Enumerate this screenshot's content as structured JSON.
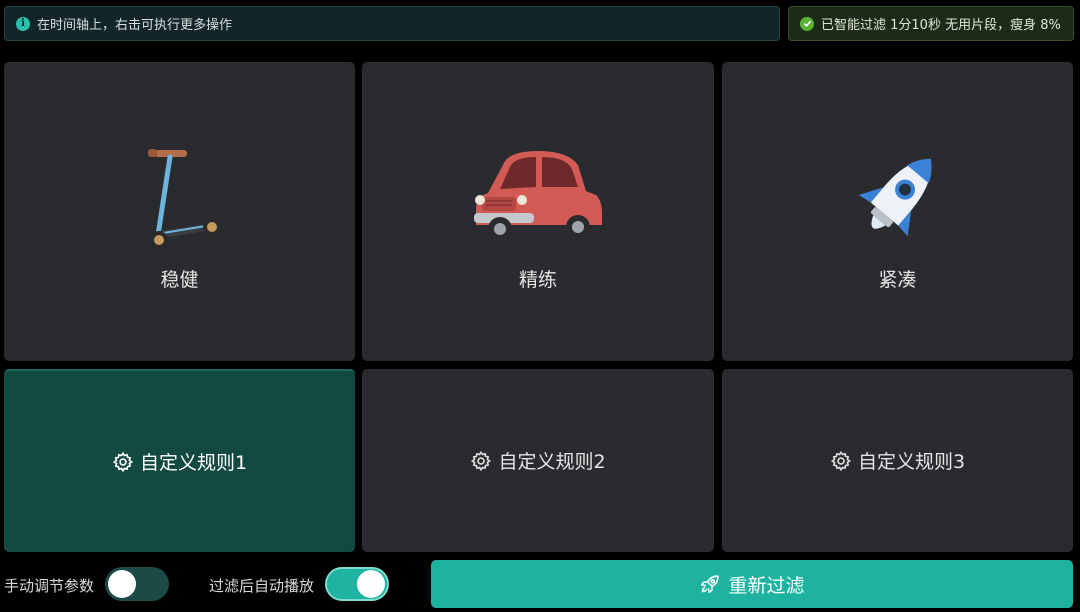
{
  "info_bar": {
    "icon": "info-icon",
    "text": "在时间轴上，右击可执行更多操作",
    "accent": "#2bbfae"
  },
  "success_bar": {
    "icon": "check-circle-icon",
    "text": "已智能过滤 1分10秒 无用片段，瘦身 8%",
    "accent": "#5bb336"
  },
  "presets": [
    {
      "label": "稳健",
      "icon": "scooter-icon"
    },
    {
      "label": "精练",
      "icon": "car-icon"
    },
    {
      "label": "紧凑",
      "icon": "rocket-icon"
    }
  ],
  "custom_rules": [
    {
      "label": "自定义规则1",
      "icon": "gear-icon",
      "selected": true
    },
    {
      "label": "自定义规则2",
      "icon": "gear-icon",
      "selected": false
    },
    {
      "label": "自定义规则3",
      "icon": "gear-icon",
      "selected": false
    }
  ],
  "controls": {
    "manual_params_label": "手动调节参数",
    "manual_params_on": false,
    "autoplay_label": "过滤后自动播放",
    "autoplay_on": true
  },
  "refilter_button": {
    "label": "重新过滤",
    "icon": "rocket-outline-icon"
  },
  "colors": {
    "accent": "#1eb3a1",
    "selected_card": "#124a42",
    "card": "#292b2f"
  }
}
